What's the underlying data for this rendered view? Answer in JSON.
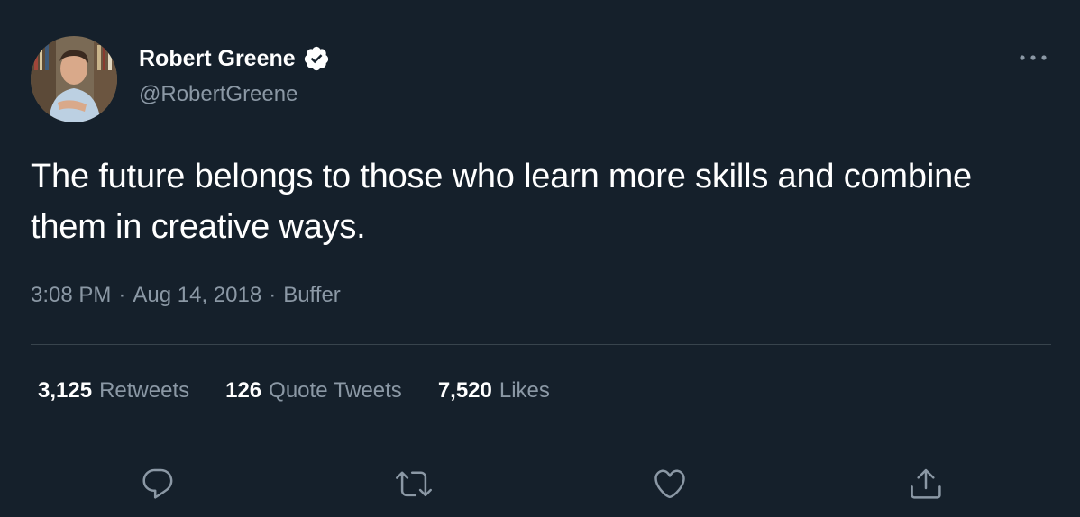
{
  "author": {
    "display_name": "Robert Greene",
    "handle": "@RobertGreene",
    "verified": true
  },
  "tweet": {
    "text": "The future belongs to those who learn more skills and combine them in creative ways.",
    "time": "3:08 PM",
    "separator1": "·",
    "date": "Aug 14, 2018",
    "separator2": "·",
    "source": "Buffer"
  },
  "stats": {
    "retweets_count": "3,125",
    "retweets_label": "Retweets",
    "quotes_count": "126",
    "quotes_label": "Quote Tweets",
    "likes_count": "7,520",
    "likes_label": "Likes"
  },
  "icons": {
    "more": "more-horizontal-icon",
    "reply": "reply-icon",
    "retweet": "retweet-icon",
    "like": "heart-icon",
    "share": "share-icon",
    "verified": "verified-badge-icon"
  },
  "colors": {
    "background": "#15202b",
    "text_primary": "#ffffff",
    "text_secondary": "#8b98a5",
    "divider": "#38444d"
  }
}
